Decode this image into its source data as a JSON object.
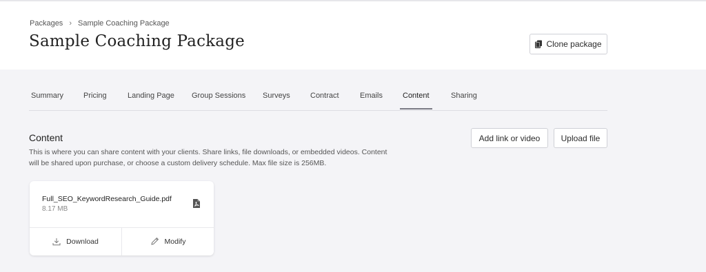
{
  "breadcrumb": {
    "root": "Packages",
    "current": "Sample Coaching Package"
  },
  "page": {
    "title": "Sample Coaching Package",
    "clone_label": "Clone package"
  },
  "tabs": [
    {
      "label": "Summary",
      "active": false
    },
    {
      "label": "Pricing",
      "active": false
    },
    {
      "label": "Landing Page",
      "active": false
    },
    {
      "label": "Group Sessions",
      "active": false
    },
    {
      "label": "Surveys",
      "active": false
    },
    {
      "label": "Contract",
      "active": false
    },
    {
      "label": "Emails",
      "active": false
    },
    {
      "label": "Content",
      "active": true
    },
    {
      "label": "Sharing",
      "active": false
    }
  ],
  "content": {
    "title": "Content",
    "description": "This is where you can share content with your clients. Share links, file downloads, or embedded videos. Content will be shared upon purchase, or choose a custom delivery schedule. Max file size is 256MB.",
    "add_label": "Add link or video",
    "upload_label": "Upload file"
  },
  "file": {
    "name": "Full_SEO_KeywordResearch_Guide.pdf",
    "size": "8.17 MB",
    "download_label": "Download",
    "modify_label": "Modify"
  },
  "icons": {
    "clone": "copy-icon",
    "file": "pdf-file-icon",
    "download": "download-icon",
    "modify": "pencil-icon",
    "breadcrumb_sep": "chevron-right-icon"
  }
}
